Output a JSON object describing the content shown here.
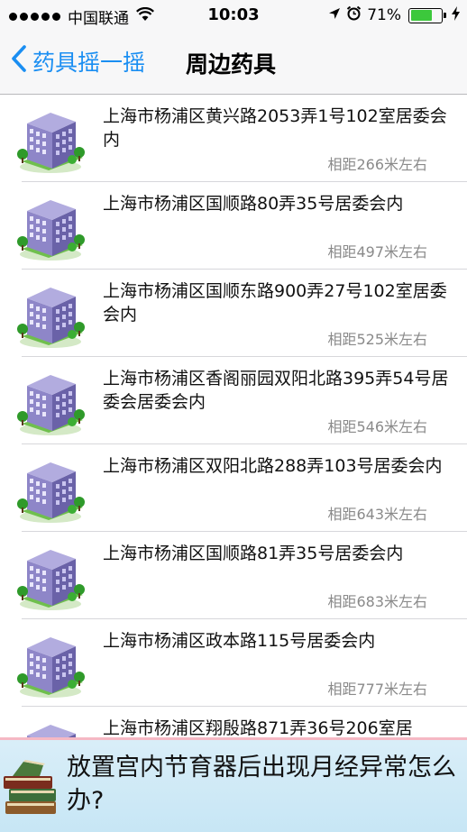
{
  "status_bar": {
    "carrier": "中国联通",
    "time": "10:03",
    "battery_percent": "71%",
    "battery_level": 0.71
  },
  "nav": {
    "back_label": "药具摇一摇",
    "title": "周边药具"
  },
  "list": {
    "items": [
      {
        "address": "上海市杨浦区黄兴路2053弄1号102室居委会内",
        "distance": "相距266米左右"
      },
      {
        "address": "上海市杨浦区国顺路80弄35号居委会内",
        "distance": "相距497米左右"
      },
      {
        "address": "上海市杨浦区国顺东路900弄27号102室居委会内",
        "distance": "相距525米左右"
      },
      {
        "address": "上海市杨浦区香阁丽园双阳北路395弄54号居委会居委会内",
        "distance": "相距546米左右"
      },
      {
        "address": "上海市杨浦区双阳北路288弄103号居委会内",
        "distance": "相距643米左右"
      },
      {
        "address": "上海市杨浦区国顺路81弄35号居委会内",
        "distance": "相距683米左右"
      },
      {
        "address": "上海市杨浦区政本路115号居委会内",
        "distance": "相距777米左右"
      },
      {
        "address": "上海市杨浦区翔殷路871弄36号206室居",
        "distance": ""
      }
    ]
  },
  "banner": {
    "text": "放置宫内节育器后出现月经异常怎么办?"
  },
  "icons": {
    "signal": "signal-dots-icon",
    "wifi": "wifi-icon",
    "location": "location-arrow-icon",
    "alarm": "alarm-clock-icon",
    "battery": "battery-icon",
    "charging": "charging-bolt-icon",
    "back": "chevron-left-icon",
    "building": "building-icon",
    "books": "books-icon"
  }
}
